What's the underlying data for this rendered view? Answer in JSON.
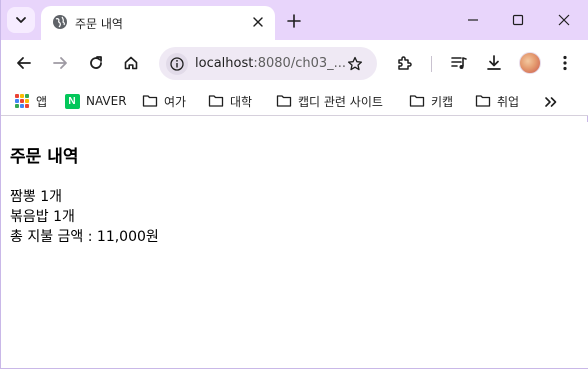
{
  "browser": {
    "tab": {
      "title": "주문 내역"
    },
    "url": {
      "host": "localhost",
      "rest": ":8080/ch03_..."
    }
  },
  "bookmarks": [
    {
      "label": "앱",
      "icon": "apps-grid-icon"
    },
    {
      "label": "NAVER",
      "icon": "naver-icon"
    },
    {
      "label": "여가",
      "icon": "folder-icon"
    },
    {
      "label": "대학",
      "icon": "folder-icon"
    },
    {
      "label": "캡디 관련 사이트",
      "icon": "folder-icon"
    },
    {
      "label": "키캡",
      "icon": "folder-icon"
    },
    {
      "label": "취업",
      "icon": "folder-icon"
    }
  ],
  "page": {
    "heading": "주문 내역",
    "lines": [
      "짬뽕 1개",
      "볶음밥 1개",
      "총 지불 금액 : 11,000원"
    ]
  },
  "colors": {
    "tabstrip": "#e8d5fb",
    "omnibox": "#efe9f4",
    "naver": "#03c75a"
  }
}
